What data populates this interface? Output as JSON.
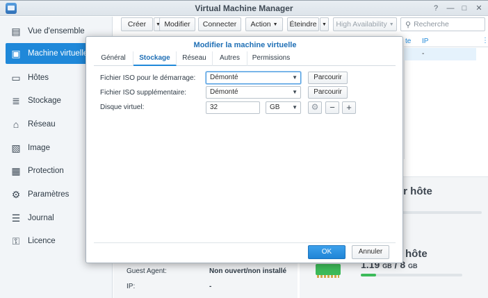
{
  "window": {
    "title": "Virtual Machine Manager",
    "help_icon": "?",
    "minimize_icon": "—",
    "maximize_icon": "□",
    "close_icon": "✕"
  },
  "sidebar": {
    "items": [
      {
        "label": "Vue d'ensemble",
        "icon": "overview-icon",
        "glyph": "▤"
      },
      {
        "label": "Machine virtuelle",
        "icon": "virtual-machine-icon",
        "glyph": "▣"
      },
      {
        "label": "Hôtes",
        "icon": "hosts-icon",
        "glyph": "▭"
      },
      {
        "label": "Stockage",
        "icon": "storage-icon",
        "glyph": "≣"
      },
      {
        "label": "Réseau",
        "icon": "network-icon",
        "glyph": "⌂"
      },
      {
        "label": "Image",
        "icon": "image-icon",
        "glyph": "▧"
      },
      {
        "label": "Protection",
        "icon": "protection-icon",
        "glyph": "▦"
      },
      {
        "label": "Paramètres",
        "icon": "settings-icon",
        "glyph": "⚙"
      },
      {
        "label": "Journal",
        "icon": "log-icon",
        "glyph": "☰"
      },
      {
        "label": "Licence",
        "icon": "license-icon",
        "glyph": "⚿"
      }
    ],
    "active_index": 1
  },
  "toolbar": {
    "create": "Créer",
    "edit": "Modifier",
    "connect": "Connecter",
    "action": "Action",
    "shutdown": "Éteindre",
    "high_availability": "High Availability",
    "search_placeholder": "Recherche"
  },
  "grid": {
    "col_partial": "te",
    "col_ip": "IP",
    "row_ip": "-"
  },
  "summary": {
    "host_title_partial": "ur hôte",
    "host_title_partial2": "hôte",
    "memory_used": "1.19",
    "memory_unit_used": "GB",
    "memory_sep": "/",
    "memory_total": "8",
    "memory_unit_total": "GB",
    "memory_fraction": 0.15,
    "guest_agent_label": "Guest Agent:",
    "guest_agent_value": "Non ouvert/non installé",
    "ip_label": "IP:",
    "ip_value": "-"
  },
  "dialog": {
    "title": "Modifier la machine virtuelle",
    "tabs": [
      "Général",
      "Stockage",
      "Réseau",
      "Autres",
      "Permissions"
    ],
    "active_tab": 1,
    "iso_boot_label": "Fichier ISO pour le démarrage:",
    "iso_boot_value": "Démonté",
    "iso_extra_label": "Fichier ISO supplémentaire:",
    "iso_extra_value": "Démonté",
    "browse": "Parcourir",
    "disk_label": "Disque virtuel:",
    "disk_size": "32",
    "disk_unit": "GB",
    "ok": "OK",
    "cancel": "Annuler"
  }
}
